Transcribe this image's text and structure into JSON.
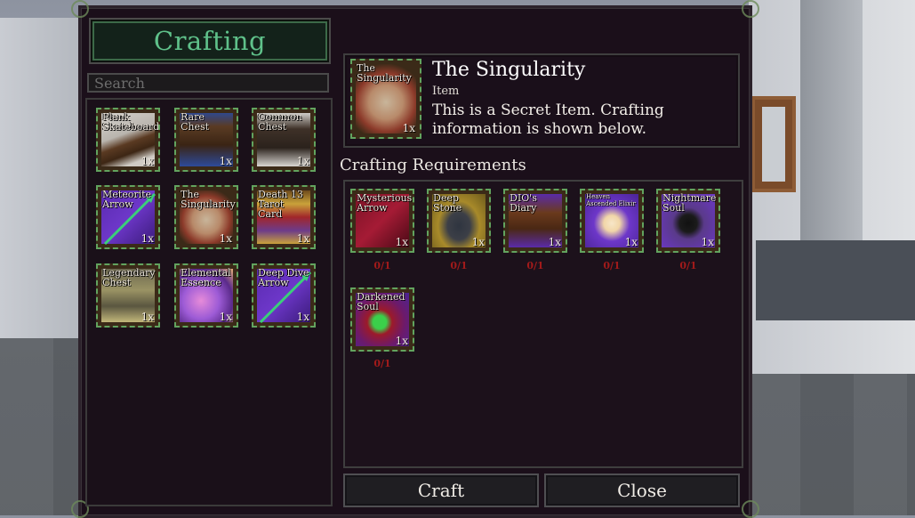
{
  "window": {
    "title": "Crafting"
  },
  "search": {
    "placeholder": "Search"
  },
  "items": [
    {
      "name": "Plank Skateboard",
      "count": "1x"
    },
    {
      "name": "Rare Chest",
      "count": "1x"
    },
    {
      "name": "Common Chest",
      "count": "1x"
    },
    {
      "name": "Meteorite Arrow",
      "count": "1x"
    },
    {
      "name": "The Singularity",
      "count": "1x"
    },
    {
      "name": "Death 13 Tarot Card",
      "count": "1x"
    },
    {
      "name": "Legendary Chest",
      "count": "1x"
    },
    {
      "name": "Elemental Essence",
      "count": "1x"
    },
    {
      "name": "Deep Dive Arrow",
      "count": "1x"
    }
  ],
  "detail": {
    "icon_name": "The Singularity",
    "icon_count": "1x",
    "name": "The Singularity",
    "type": "Item",
    "description": "This is a Secret Item. Crafting information is shown below."
  },
  "requirements": {
    "title": "Crafting Requirements",
    "items": [
      {
        "name": "Mysterious Arrow",
        "count": "1x",
        "have": "0/1"
      },
      {
        "name": "Deep Stone",
        "count": "1x",
        "have": "0/1"
      },
      {
        "name": "DIO's Diary",
        "count": "1x",
        "have": "0/1"
      },
      {
        "name": "Heaven Ascended Elixir",
        "count": "1x",
        "have": "0/1"
      },
      {
        "name": "Nightmare Soul",
        "count": "1x",
        "have": "0/1"
      },
      {
        "name": "Darkened Soul",
        "count": "1x",
        "have": "0/1"
      }
    ]
  },
  "buttons": {
    "craft": "Craft",
    "close": "Close"
  },
  "icons": {
    "item_art": [
      "plank-skateboard-icon",
      "rare-chest-icon",
      "common-chest-icon",
      "meteorite-arrow-icon",
      "singularity-icon",
      "tarot-card-icon",
      "legendary-chest-icon",
      "elemental-essence-icon",
      "deep-dive-arrow-icon"
    ]
  },
  "colors": {
    "accent_green": "#5fc18a",
    "slot_border": "#62a35e",
    "missing_red": "#a11a1a"
  }
}
